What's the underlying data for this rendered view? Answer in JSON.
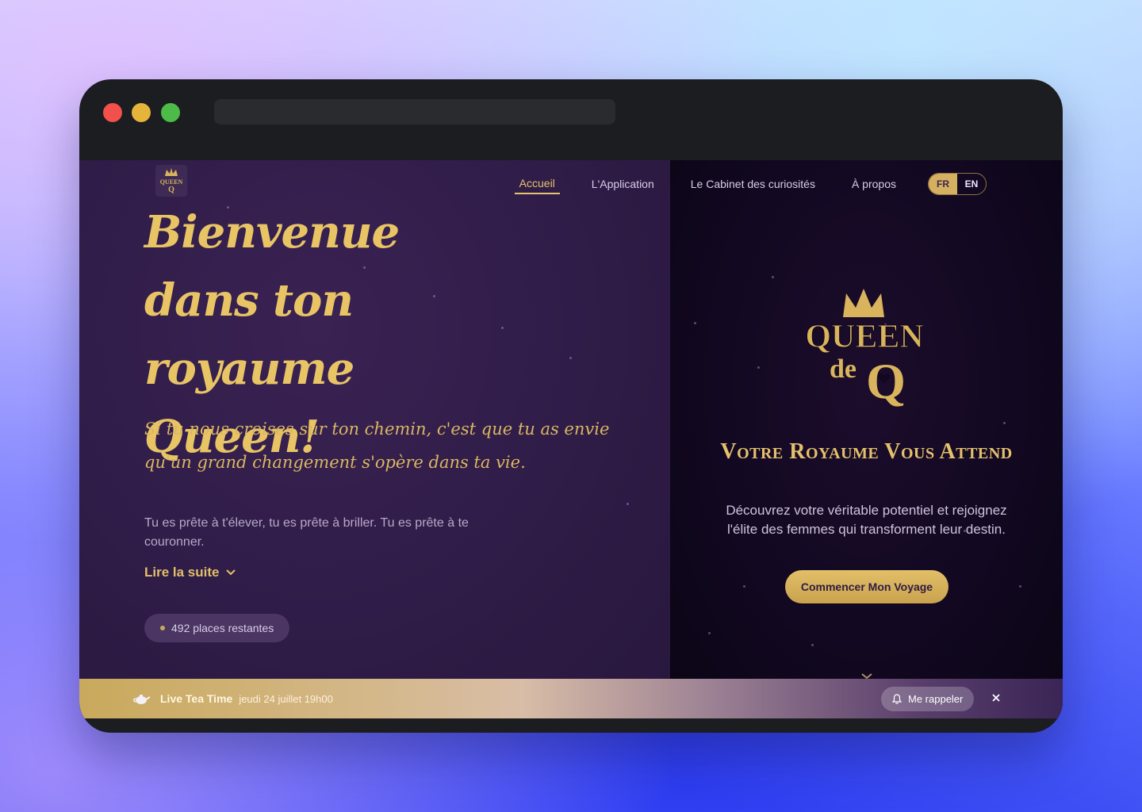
{
  "nav": {
    "items": [
      {
        "label": "Accueil",
        "active": true
      },
      {
        "label": "L'Application",
        "active": false
      },
      {
        "label": "Le Cabinet des curiosités",
        "active": false
      },
      {
        "label": "À propos",
        "active": false
      }
    ],
    "lang": {
      "fr": "FR",
      "en": "EN",
      "selected": "FR"
    }
  },
  "hero": {
    "title": "Bienvenue dans ton royaume Queen!",
    "quote": "Si tu nous croises sur ton chemin, c'est que tu as envie qu'un grand changement s'opère dans ta vie.",
    "text": "Tu es prête à t'élever, tu es prête à briller. Tu es prête à te couronner.",
    "read_more": "Lire la suite",
    "places": "492 places restantes"
  },
  "side": {
    "logo_text_top": "QUEEN",
    "logo_text_mid": "de",
    "logo_text_bottom": "Q",
    "title": "Votre Royaume Vous Attend",
    "text": "Découvrez votre véritable potentiel et rejoignez l'élite des femmes qui transforment leur destin.",
    "cta": "Commencer Mon Voyage"
  },
  "banner": {
    "title": "Live Tea Time",
    "date": "jeudi 24 juillet 19h00",
    "remind": "Me rappeler"
  },
  "colors": {
    "gold": "#e6c36e",
    "left_bg": "#2f1c47",
    "right_bg": "#120821"
  },
  "icons": {
    "crown": "crown-icon",
    "chevron": "chevron-down-icon",
    "bell": "bell-icon",
    "close": "close-icon",
    "teapot": "teapot-icon"
  }
}
